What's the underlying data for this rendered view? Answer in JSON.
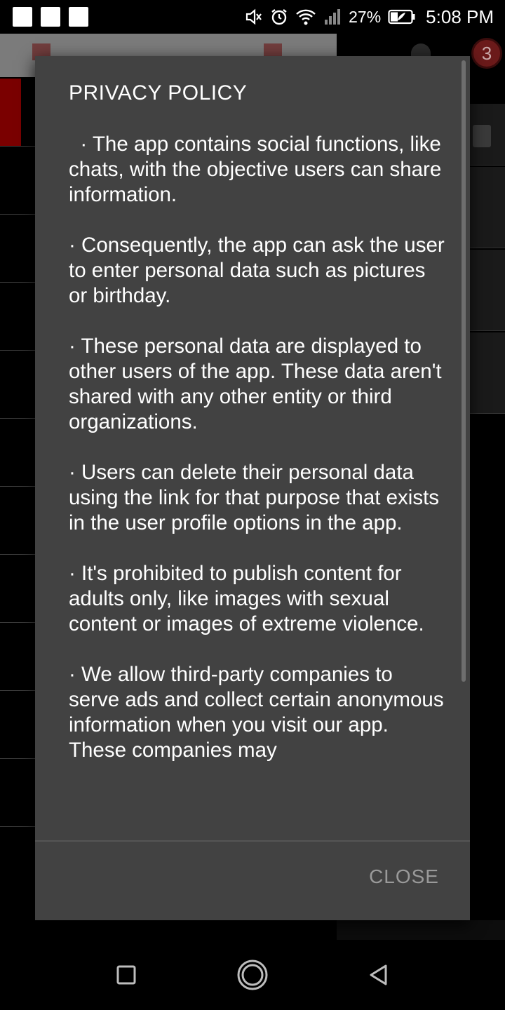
{
  "status_bar": {
    "battery_percent": "27%",
    "time": "5:08 PM",
    "icons": [
      "notification-square-icon",
      "notification-square-icon",
      "notification-square-icon",
      "mute-icon",
      "alarm-icon",
      "wifi-icon",
      "signal-icon",
      "battery-saver-icon"
    ]
  },
  "background_app": {
    "badge_count": "3",
    "icons": [
      "person-icon",
      "trash-icon"
    ]
  },
  "dialog": {
    "title": "PRIVACY POLICY",
    "paragraphs": [
      "  · The app contains social functions, like chats, with the objective users can share information.",
      "· Consequently, the app can ask the user to enter personal data such as pictures or birthday.",
      "· These personal data are displayed to other users of the app. These data aren't shared with any other entity or third organizations.",
      "· Users can delete their personal data using the link for that purpose that exists in the user profile options in the app.",
      "· It's prohibited to publish content for adults only, like images with sexual content or images of extreme violence.",
      "· We allow third-party companies to serve ads and collect certain anonymous information when you visit our app. These companies may"
    ],
    "close_label": "CLOSE"
  },
  "nav_bar": {
    "icons": [
      "recents-icon",
      "home-icon",
      "back-icon"
    ]
  },
  "colors": {
    "dialog_bg": "#424242",
    "close_text": "#9a9a9a",
    "accent_red": "#7a0000"
  }
}
